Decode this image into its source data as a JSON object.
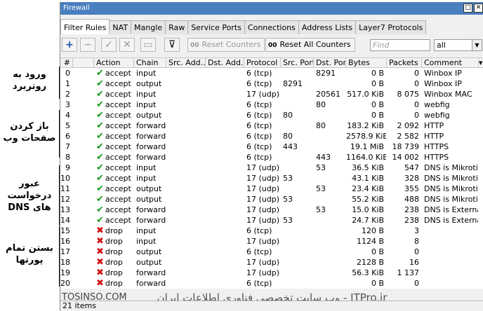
{
  "window": {
    "title": "Firewall",
    "btn_restore": "□",
    "btn_close": "✕"
  },
  "tabs": [
    "Filter Rules",
    "NAT",
    "Mangle",
    "Raw",
    "Service Ports",
    "Connections",
    "Address Lists",
    "Layer7 Protocols"
  ],
  "toolbar": {
    "add": "+",
    "remove": "−",
    "enable": "✓",
    "disable": "✕",
    "comment": "▭",
    "filter": "⊽",
    "reset_counters_prefix": "00",
    "reset_counters": "Reset Counters",
    "reset_all_prefix": "00",
    "reset_all": "Reset All Counters",
    "find_placeholder": "Find",
    "select_value": "all",
    "select_arrow": "▼"
  },
  "columns": [
    "#",
    "",
    "Action",
    "Chain",
    "Src. Add...",
    "Dst. Add...",
    "Protocol",
    "Src. Port",
    "Dst. Port",
    "Bytes",
    "Packets",
    "Comment",
    "▼"
  ],
  "rows": [
    {
      "n": "0",
      "action": "accept",
      "chain": "input",
      "proto": "6 (tcp)",
      "sport": "",
      "dport": "8291",
      "bytes": "0 B",
      "packets": "0",
      "comment": "Winbox IP"
    },
    {
      "n": "1",
      "action": "accept",
      "chain": "output",
      "proto": "6 (tcp)",
      "sport": "8291",
      "dport": "",
      "bytes": "0 B",
      "packets": "0",
      "comment": "Winbox IP"
    },
    {
      "n": "2",
      "action": "accept",
      "chain": "input",
      "proto": "17 (udp)",
      "sport": "",
      "dport": "20561",
      "bytes": "517.0 KiB",
      "packets": "8 075",
      "comment": "Winbox MAC"
    },
    {
      "n": "3",
      "action": "accept",
      "chain": "input",
      "proto": "6 (tcp)",
      "sport": "",
      "dport": "80",
      "bytes": "0 B",
      "packets": "0",
      "comment": "webfig"
    },
    {
      "n": "4",
      "action": "accept",
      "chain": "output",
      "proto": "6 (tcp)",
      "sport": "80",
      "dport": "",
      "bytes": "0 B",
      "packets": "0",
      "comment": "webfig"
    },
    {
      "n": "5",
      "action": "accept",
      "chain": "forward",
      "proto": "6 (tcp)",
      "sport": "",
      "dport": "80",
      "bytes": "183.2 KiB",
      "packets": "2 092",
      "comment": "HTTP"
    },
    {
      "n": "6",
      "action": "accept",
      "chain": "forward",
      "proto": "6 (tcp)",
      "sport": "80",
      "dport": "",
      "bytes": "2578.9 KiB",
      "packets": "2 582",
      "comment": "HTTP"
    },
    {
      "n": "7",
      "action": "accept",
      "chain": "forward",
      "proto": "6 (tcp)",
      "sport": "443",
      "dport": "",
      "bytes": "19.1 MiB",
      "packets": "18 739",
      "comment": "HTTPS"
    },
    {
      "n": "8",
      "action": "accept",
      "chain": "forward",
      "proto": "6 (tcp)",
      "sport": "",
      "dport": "443",
      "bytes": "1164.0 KiB",
      "packets": "14 002",
      "comment": "HTTPS"
    },
    {
      "n": "9",
      "action": "accept",
      "chain": "input",
      "proto": "17 (udp)",
      "sport": "",
      "dport": "53",
      "bytes": "36.5 KiB",
      "packets": "547",
      "comment": "DNS is Mikrotik"
    },
    {
      "n": "10",
      "action": "accept",
      "chain": "input",
      "proto": "17 (udp)",
      "sport": "53",
      "dport": "",
      "bytes": "43.1 KiB",
      "packets": "328",
      "comment": "DNS is Mikrotik"
    },
    {
      "n": "11",
      "action": "accept",
      "chain": "output",
      "proto": "17 (udp)",
      "sport": "",
      "dport": "53",
      "bytes": "23.4 KiB",
      "packets": "355",
      "comment": "DNS is Mikrotik"
    },
    {
      "n": "12",
      "action": "accept",
      "chain": "output",
      "proto": "17 (udp)",
      "sport": "53",
      "dport": "",
      "bytes": "55.2 KiB",
      "packets": "488",
      "comment": "DNS is Mikrotik"
    },
    {
      "n": "13",
      "action": "accept",
      "chain": "forward",
      "proto": "17 (udp)",
      "sport": "",
      "dport": "53",
      "bytes": "15.0 KiB",
      "packets": "238",
      "comment": "DNS is External"
    },
    {
      "n": "14",
      "action": "accept",
      "chain": "forward",
      "proto": "17 (udp)",
      "sport": "53",
      "dport": "",
      "bytes": "24.7 KiB",
      "packets": "238",
      "comment": "DNS is External"
    },
    {
      "n": "15",
      "action": "drop",
      "chain": "input",
      "proto": "6 (tcp)",
      "sport": "",
      "dport": "",
      "bytes": "120 B",
      "packets": "3",
      "comment": ""
    },
    {
      "n": "16",
      "action": "drop",
      "chain": "input",
      "proto": "17 (udp)",
      "sport": "",
      "dport": "",
      "bytes": "1124 B",
      "packets": "8",
      "comment": ""
    },
    {
      "n": "17",
      "action": "drop",
      "chain": "output",
      "proto": "6 (tcp)",
      "sport": "",
      "dport": "",
      "bytes": "0 B",
      "packets": "0",
      "comment": ""
    },
    {
      "n": "18",
      "action": "drop",
      "chain": "output",
      "proto": "17 (udp)",
      "sport": "",
      "dport": "",
      "bytes": "2128 B",
      "packets": "16",
      "comment": ""
    },
    {
      "n": "19",
      "action": "drop",
      "chain": "forward",
      "proto": "17 (udp)",
      "sport": "",
      "dport": "",
      "bytes": "56.3 KiB",
      "packets": "1 137",
      "comment": ""
    },
    {
      "n": "20",
      "action": "drop",
      "chain": "forward",
      "proto": "6 (tcp)",
      "sport": "",
      "dport": "",
      "bytes": "0 B",
      "packets": "0",
      "comment": ""
    }
  ],
  "status": "21 items",
  "watermark": "ITPro.ir - وب سایت تخصصی فناوری اطلاعات ایران",
  "watermark_left": "TOSINSO.COM",
  "annotations": [
    {
      "line1": "ورود به",
      "line2": "روتربرد"
    },
    {
      "line1": "باز کردن",
      "line2": "صفحات وب"
    },
    {
      "line1": "عبور درخواست",
      "line2": "های DNS"
    },
    {
      "line1": "بستن تمام",
      "line2": "پورتها"
    }
  ],
  "colors": {
    "accept": "#1a9a1a",
    "drop": "#d01010",
    "titlebar": "#4a7fc0"
  }
}
